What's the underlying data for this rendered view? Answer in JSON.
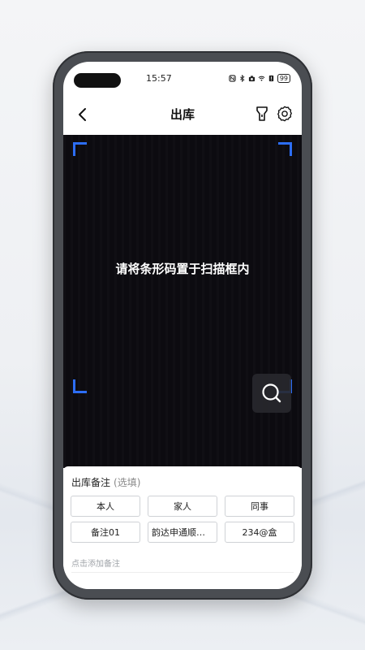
{
  "status_bar": {
    "time": "15:57",
    "battery": "99"
  },
  "header": {
    "title": "出库"
  },
  "scanner": {
    "hint": "请将条形码置于扫描框内",
    "frame_color": "#2d6ef5"
  },
  "remark_panel": {
    "label": "出库备注",
    "optional_label": "(选填)",
    "tags": [
      "本人",
      "家人",
      "同事",
      "备注01",
      "韵达申通顺丰...",
      "234@盒"
    ],
    "note_placeholder": "点击添加备注"
  }
}
